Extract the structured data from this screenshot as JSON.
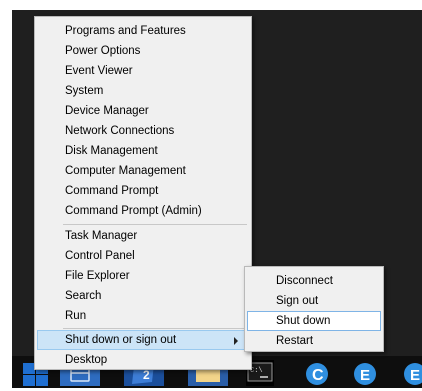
{
  "menu": {
    "items": [
      {
        "label": "Programs and Features"
      },
      {
        "label": "Power Options"
      },
      {
        "label": "Event Viewer"
      },
      {
        "label": "System"
      },
      {
        "label": "Device Manager"
      },
      {
        "label": "Network Connections"
      },
      {
        "label": "Disk Management"
      },
      {
        "label": "Computer Management"
      },
      {
        "label": "Command Prompt"
      },
      {
        "label": "Command Prompt (Admin)"
      },
      {
        "label": "Task Manager"
      },
      {
        "label": "Control Panel"
      },
      {
        "label": "File Explorer"
      },
      {
        "label": "Search"
      },
      {
        "label": "Run"
      },
      {
        "label": "Shut down or sign out",
        "highlighted": true,
        "has_submenu": true
      },
      {
        "label": "Desktop"
      }
    ]
  },
  "submenu": {
    "items": [
      {
        "label": "Disconnect"
      },
      {
        "label": "Sign out"
      },
      {
        "label": "Shut down",
        "highlighted": true
      },
      {
        "label": "Restart"
      }
    ]
  },
  "taskbar": {
    "icons": [
      "windows-start-icon",
      "server-manager-icon",
      "powershell-icon",
      "file-explorer-icon",
      "command-prompt-icon",
      "chrome-icon",
      "edge-icon",
      "edge-icon-2"
    ]
  },
  "colors": {
    "menu_bg": "#f0f0f0",
    "highlight": "#cce4f7",
    "taskbar": "#0e0e0e",
    "desktop": "#1f1f1f",
    "accent_blue": "#1f6fd1"
  }
}
